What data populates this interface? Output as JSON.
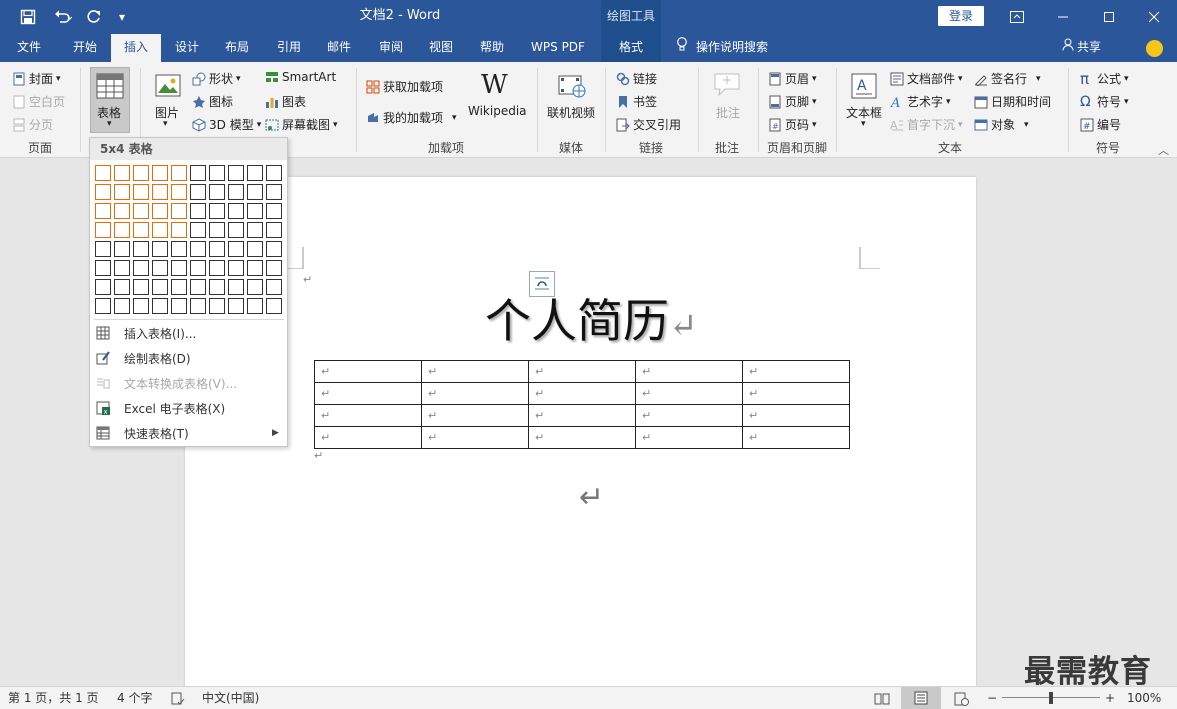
{
  "titlebar": {
    "doc_title": "文档2  -  Word",
    "drawing_tools": "绘图工具",
    "login": "登录"
  },
  "tabs": [
    {
      "label": "文件"
    },
    {
      "label": "开始"
    },
    {
      "label": "插入"
    },
    {
      "label": "设计"
    },
    {
      "label": "布局"
    },
    {
      "label": "引用"
    },
    {
      "label": "邮件"
    },
    {
      "label": "审阅"
    },
    {
      "label": "视图"
    },
    {
      "label": "帮助"
    },
    {
      "label": "WPS PDF"
    },
    {
      "label": "格式"
    }
  ],
  "tell_me": "操作说明搜索",
  "share": "共享",
  "ribbon": {
    "pages": {
      "cover": "封面",
      "blank": "空白页",
      "break": "分页",
      "label": "页面"
    },
    "tables": {
      "table": "表格"
    },
    "illustrations": {
      "pictures": "图片",
      "shapes": "形状",
      "icons": "图标",
      "model3d": "3D 模型",
      "smartart": "SmartArt",
      "chart": "图表",
      "screenshot": "屏幕截图"
    },
    "addins": {
      "get": "获取加载项",
      "my": "我的加载项",
      "wikipedia": "Wikipedia",
      "label": "加载项"
    },
    "media": {
      "video": "联机视频",
      "label": "媒体"
    },
    "links": {
      "link": "链接",
      "bookmark": "书签",
      "crossref": "交叉引用",
      "label": "链接"
    },
    "comments": {
      "comment": "批注",
      "label": "批注"
    },
    "header_footer": {
      "header": "页眉",
      "footer": "页脚",
      "pagenum": "页码",
      "label": "页眉和页脚"
    },
    "text": {
      "textbox": "文本框",
      "quickparts": "文档部件",
      "wordart": "艺术字",
      "dropcap": "首字下沉",
      "signature": "签名行",
      "datetime": "日期和时间",
      "object": "对象",
      "label": "文本"
    },
    "symbols": {
      "equation": "公式",
      "symbol": "符号",
      "number": "编号",
      "label": "符号"
    }
  },
  "dropdown": {
    "header": "5x4 表格",
    "grid_cols": 10,
    "grid_rows": 8,
    "sel_cols": 5,
    "sel_rows": 4,
    "items": [
      {
        "label": "插入表格(I)..."
      },
      {
        "label": "绘制表格(D)"
      },
      {
        "label": "文本转换成表格(V)..."
      },
      {
        "label": "Excel 电子表格(X)"
      },
      {
        "label": "快速表格(T)"
      }
    ]
  },
  "document": {
    "heading": "个人简历",
    "return_mark": "↵",
    "table_rows": 4,
    "table_cols": 5
  },
  "status": {
    "page": "第 1 页，共 1 页",
    "words": "4 个字",
    "lang": "中文(中国)",
    "zoom": "100%"
  },
  "watermark": "最需教育",
  "colors": {
    "accent": "#2b579a",
    "grid_selected": "#e46c0a"
  }
}
